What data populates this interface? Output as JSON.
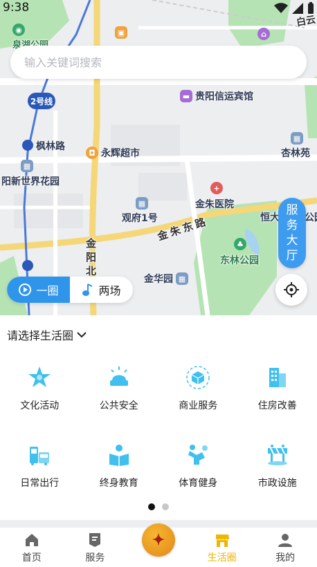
{
  "status_bar": {
    "time": "9:38"
  },
  "search": {
    "placeholder": "输入关键词搜索"
  },
  "map": {
    "line_badge": "2号线",
    "pois": {
      "quanhu_park": "泉湖公园",
      "xinyun_hotel": "贵阳信运宾馆",
      "fenglin_road": "枫林路",
      "yonghui_market": "永辉超市",
      "xinglin_yuan": "杏林苑",
      "new_world_garden": "阳新世界花园",
      "jinzhu_hospital": "金朱医院",
      "guanfu_1": "观府1号",
      "hengda": "恒大",
      "park_right": "公园",
      "donglin_park": "东林公园",
      "jinhua_garden": "金华园",
      "bai_partial": "白云",
      "jinzhu_east_road": "金朱东路",
      "jinyang_north_road": "金阳北路"
    }
  },
  "service_hall": {
    "label": [
      "服",
      "务",
      "大",
      "厅"
    ]
  },
  "circle_toggle": {
    "option_1": "一圈",
    "option_2": "两场"
  },
  "panel": {
    "title": "请选择生活圈",
    "items": [
      {
        "label": "文化活动",
        "icon": "star-icon"
      },
      {
        "label": "公共安全",
        "icon": "alarm-icon"
      },
      {
        "label": "商业服务",
        "icon": "cube-icon"
      },
      {
        "label": "住房改善",
        "icon": "building-icon"
      },
      {
        "label": "日常出行",
        "icon": "bus-icon"
      },
      {
        "label": "终身教育",
        "icon": "reading-icon"
      },
      {
        "label": "体育健身",
        "icon": "fitness-icon"
      },
      {
        "label": "市政设施",
        "icon": "barrier-icon"
      }
    ],
    "page_indicator": {
      "current": 1,
      "total": 2
    }
  },
  "tab_bar": {
    "tabs": [
      {
        "label": "首页",
        "icon": "home-icon"
      },
      {
        "label": "服务",
        "icon": "document-icon"
      },
      {
        "label": "",
        "icon": "logo-icon"
      },
      {
        "label": "生活圈",
        "icon": "shop-icon"
      },
      {
        "label": "我的",
        "icon": "user-icon"
      }
    ],
    "active_index": 3
  },
  "colors": {
    "accent_blue": "#2f95ea",
    "tab_active": "#f0b500",
    "icon_cyan": "#3fc0ef"
  }
}
